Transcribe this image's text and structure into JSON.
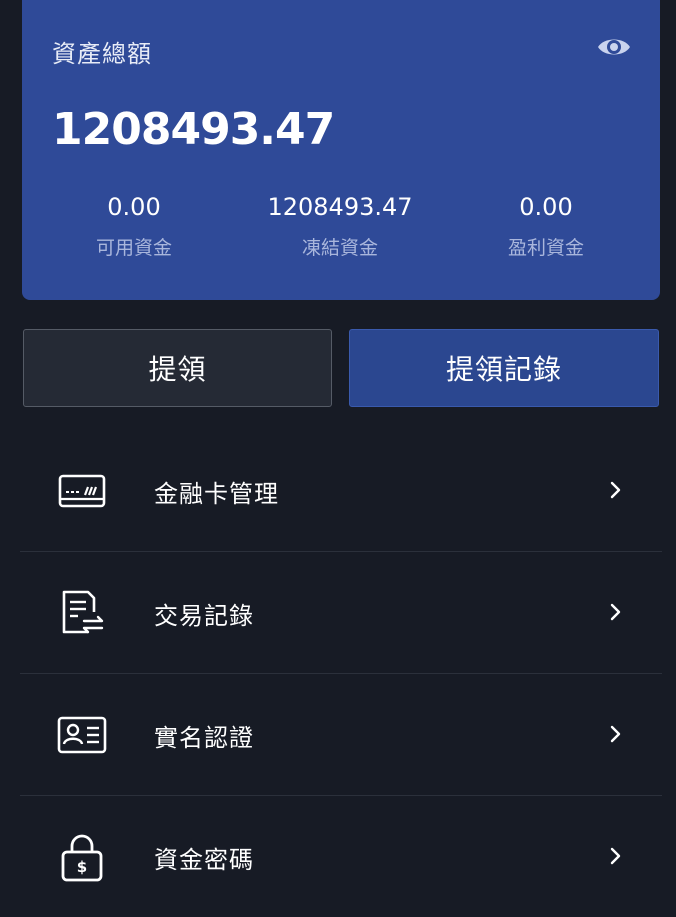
{
  "asset_card": {
    "title": "資產總額",
    "total": "1208493.47",
    "stats": [
      {
        "value": "0.00",
        "label": "可用資金"
      },
      {
        "value": "1208493.47",
        "label": "凍結資金"
      },
      {
        "value": "0.00",
        "label": "盈利資金"
      }
    ],
    "visibility_icon": "eye-icon"
  },
  "actions": {
    "withdraw_label": "提領",
    "records_label": "提領記錄"
  },
  "menu": [
    {
      "icon": "bank-card-icon",
      "label": "金融卡管理"
    },
    {
      "icon": "transaction-record-icon",
      "label": "交易記錄"
    },
    {
      "icon": "id-card-icon",
      "label": "實名認證"
    },
    {
      "icon": "lock-icon",
      "label": "資金密碼"
    }
  ],
  "colors": {
    "background": "#171b25",
    "card": "#2f4a98",
    "primary_button": "#2b4790",
    "secondary_button": "#252a35"
  }
}
